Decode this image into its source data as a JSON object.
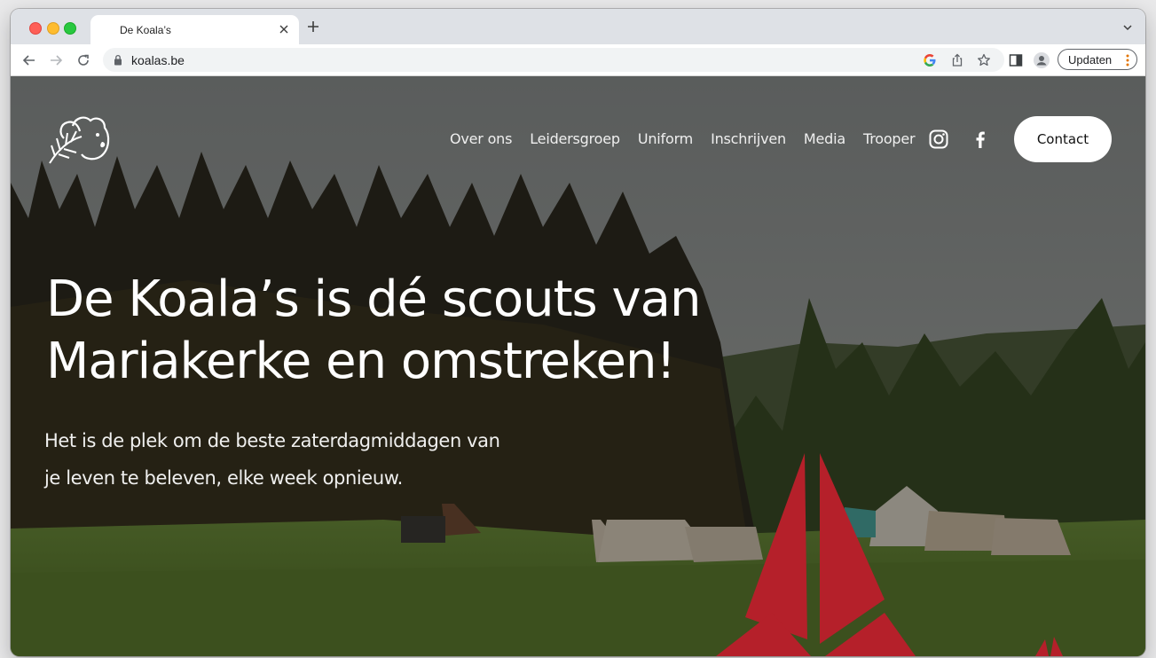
{
  "browser": {
    "tab_title": "De Koala’s",
    "url": "koalas.be",
    "update_label": "Updaten"
  },
  "icons": {
    "tab_close": "close-icon",
    "new_tab": "plus-icon",
    "tab_menu": "chevron-down-icon",
    "back": "arrow-left-icon",
    "forward": "arrow-right-icon",
    "reload": "reload-icon",
    "lock": "lock-icon",
    "google": "google-icon",
    "share": "share-icon",
    "bookmark": "star-icon",
    "side_panel": "side-panel-icon",
    "profile": "profile-icon",
    "menu": "kebab-menu-icon",
    "site_logo": "koala-logo-icon",
    "instagram": "instagram-icon",
    "facebook": "facebook-icon"
  },
  "site": {
    "nav": [
      {
        "label": "Over ons"
      },
      {
        "label": "Leidersgroep"
      },
      {
        "label": "Uniform"
      },
      {
        "label": "Inschrijven"
      },
      {
        "label": "Media"
      },
      {
        "label": "Trooper"
      }
    ],
    "contact_label": "Contact",
    "headline_line1": "De Koala’s is dé scouts van",
    "headline_line2": "Mariakerke en omstreken!",
    "sub_line1": "Het is de plek om de beste zaterdagmiddagen van",
    "sub_line2": "je leven te beleven, elke week opnieuw."
  },
  "colors": {
    "brand_red": "#b5202a",
    "overlay": "rgba(0,0,0,0.35)",
    "tab_strip": "#dee1e6",
    "omnibox": "#f1f3f4"
  }
}
